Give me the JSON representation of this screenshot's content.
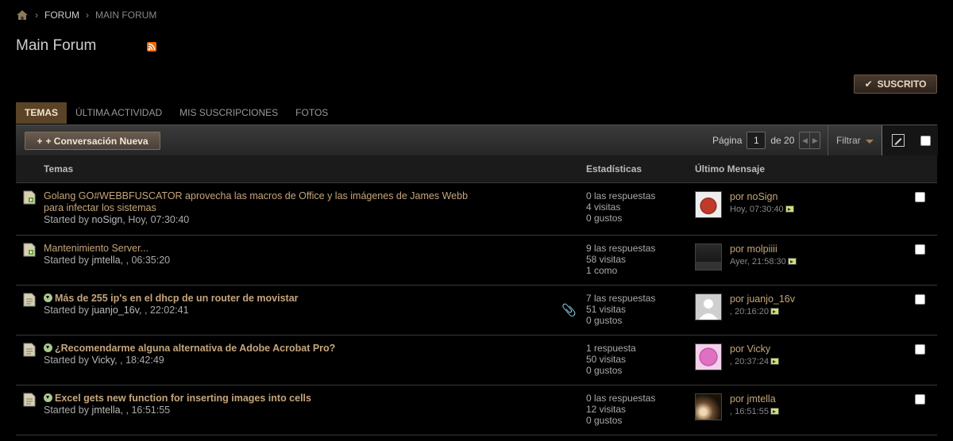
{
  "breadcrumb": {
    "items": [
      "FORUM",
      "MAIN FORUM"
    ]
  },
  "page": {
    "title": "Main Forum"
  },
  "subscribe_label": "SUSCRITO",
  "tabs": [
    "TEMAS",
    "ÚLTIMA ACTIVIDAD",
    "MIS SUSCRIPCIONES",
    "FOTOS"
  ],
  "toolbar": {
    "new_label": "+ Conversación Nueva",
    "page_label": "Página",
    "page_current": "1",
    "page_of": "de 20",
    "filter_label": "Filtrar"
  },
  "columns": {
    "topics": "Temas",
    "stats": "Estadísticas",
    "last": "Último Mensaje"
  },
  "rows": [
    {
      "title": "Golang GO#WEBBFUSCATOR aprovecha las macros de Office y las imágenes de James Webb para infectar los sistemas",
      "bold": false,
      "started_prefix": "Started by ",
      "user": "noSign",
      "started_suffix": ", Hoy, 07:30:40",
      "stats": [
        "0 las respuestas",
        "4 visitas",
        "0 gustos"
      ],
      "last_by": "por noSign",
      "last_time": "Hoy, 07:30:40",
      "icon": "new-post-icon"
    },
    {
      "title": "Mantenimiento Server...",
      "bold": false,
      "started_prefix": "Started by ",
      "user": "jmtella",
      "started_suffix": ", , 06:35:20",
      "stats": [
        "9 las respuestas",
        "58 visitas",
        "1 como"
      ],
      "last_by": "por molpiiii",
      "last_time": "Ayer, 21:58:30",
      "icon": "new-post-icon"
    },
    {
      "title": "Más de 255 ip's en el dhcp de un router de movistar",
      "bold": true,
      "started_prefix": "Started by ",
      "user": "juanjo_16v",
      "started_suffix": ", , 22:02:41",
      "stats": [
        "7 las respuestas",
        "51 visitas",
        "0 gustos"
      ],
      "last_by": "por juanjo_16v",
      "last_time": ", 20:16:20",
      "icon": "thread-icon"
    },
    {
      "title": "¿Recomendarme alguna alternativa de Adobe Acrobat Pro?",
      "bold": true,
      "started_prefix": "Started by ",
      "user": "Vicky",
      "started_suffix": ", , 18:42:49",
      "stats": [
        "1 respuesta",
        "50 visitas",
        "0 gustos"
      ],
      "last_by": "por Vicky",
      "last_time": ", 20:37:24",
      "icon": "thread-icon"
    },
    {
      "title": "Excel gets new function for inserting images into cells",
      "bold": true,
      "started_prefix": "Started by ",
      "user": "jmtella",
      "started_suffix": ", , 16:51:55",
      "stats": [
        "0 las respuestas",
        "12 visitas",
        "0 gustos"
      ],
      "last_by": "por jmtella",
      "last_time": ", 16:51:55",
      "icon": "thread-icon"
    }
  ],
  "colors": {
    "accent": "#c5a57c",
    "tab_active": "#5a4326",
    "background": "#000000"
  }
}
